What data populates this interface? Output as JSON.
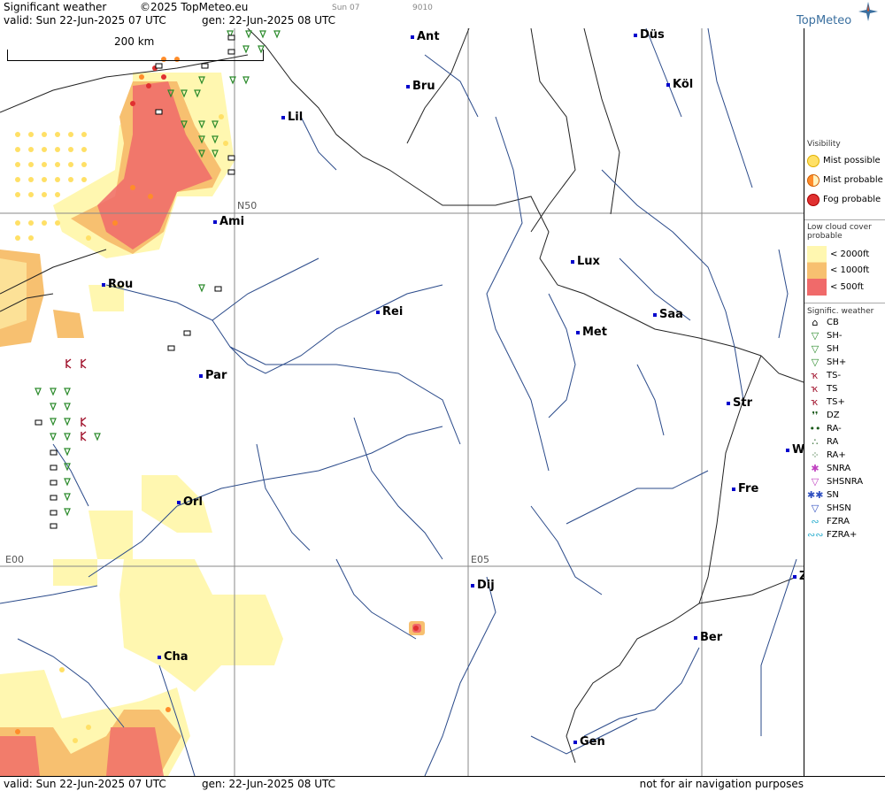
{
  "header": {
    "title": "Significant weather",
    "copyright": "©2025 TopMeteo.eu",
    "valid": "valid:  Sun  22-Jun-2025  07 UTC",
    "gen": "gen: 22-Jun-2025 08 UTC",
    "tiny1": "Sun 07",
    "tiny2": "9010",
    "logo_text": "TopMeteo"
  },
  "map": {
    "scale_label": "200 km",
    "grid_labels": {
      "n50": "N50",
      "e00": "E00",
      "e05": "E05"
    },
    "cities": [
      {
        "name": "Ant"
      },
      {
        "name": "Düs"
      },
      {
        "name": "Köl"
      },
      {
        "name": "Bru"
      },
      {
        "name": "Lil"
      },
      {
        "name": "Ami"
      },
      {
        "name": "Lux"
      },
      {
        "name": "Rou"
      },
      {
        "name": "Rei"
      },
      {
        "name": "Saa"
      },
      {
        "name": "Met"
      },
      {
        "name": "Par"
      },
      {
        "name": "Str"
      },
      {
        "name": "W"
      },
      {
        "name": "Fre"
      },
      {
        "name": "Orl"
      },
      {
        "name": "Dij"
      },
      {
        "name": "Ber"
      },
      {
        "name": "Cha"
      },
      {
        "name": "Gen"
      },
      {
        "name": "Z"
      }
    ]
  },
  "footer": {
    "valid": "valid:  Sun  22-Jun-2025  07 UTC",
    "gen": "gen: 22-Jun-2025 08 UTC",
    "note": "not for air navigation purposes"
  },
  "legend": {
    "visibility_title": "Visibility",
    "mist_possible": "Mist possible",
    "mist_probable": "Mist probable",
    "fog_probable": "Fog probable",
    "cloud_title": "Low cloud cover probable",
    "c2000": "< 2000ft",
    "c1000": "< 1000ft",
    "c500": "<   500ft",
    "sigwx_title": "Signific. weather",
    "items": [
      {
        "sym": "⌂",
        "label": "CB",
        "color": "#000"
      },
      {
        "sym": "▽",
        "label": "SH-",
        "color": "#2a8a2a"
      },
      {
        "sym": "▽",
        "label": "SH",
        "color": "#2a8a2a"
      },
      {
        "sym": "▽",
        "label": "SH+",
        "color": "#2a8a2a"
      },
      {
        "sym": "ҡ",
        "label": "TS-",
        "color": "#a0102a"
      },
      {
        "sym": "ҡ",
        "label": "TS",
        "color": "#a0102a"
      },
      {
        "sym": "ҡ",
        "label": "TS+",
        "color": "#a0102a"
      },
      {
        "sym": "❜❜",
        "label": "DZ",
        "color": "#1a5a1a"
      },
      {
        "sym": "••",
        "label": "RA-",
        "color": "#1a5a1a"
      },
      {
        "sym": "∴",
        "label": "RA",
        "color": "#1a5a1a"
      },
      {
        "sym": "⁘",
        "label": "RA+",
        "color": "#1a5a1a"
      },
      {
        "sym": "✱",
        "label": "SNRA",
        "color": "#c040c0"
      },
      {
        "sym": "▽",
        "label": "SHSNRA",
        "color": "#c040c0"
      },
      {
        "sym": "✱✱",
        "label": "SN",
        "color": "#3050c0"
      },
      {
        "sym": "▽",
        "label": "SHSN",
        "color": "#3050c0"
      },
      {
        "sym": "∾",
        "label": "FZRA",
        "color": "#30b0d0"
      },
      {
        "sym": "∾∾",
        "label": "FZRA+",
        "color": "#30b0d0"
      }
    ],
    "colors": {
      "mist": "#fff7b0",
      "mist_prob": "#f7c070",
      "fog": "#f06a6a"
    }
  }
}
